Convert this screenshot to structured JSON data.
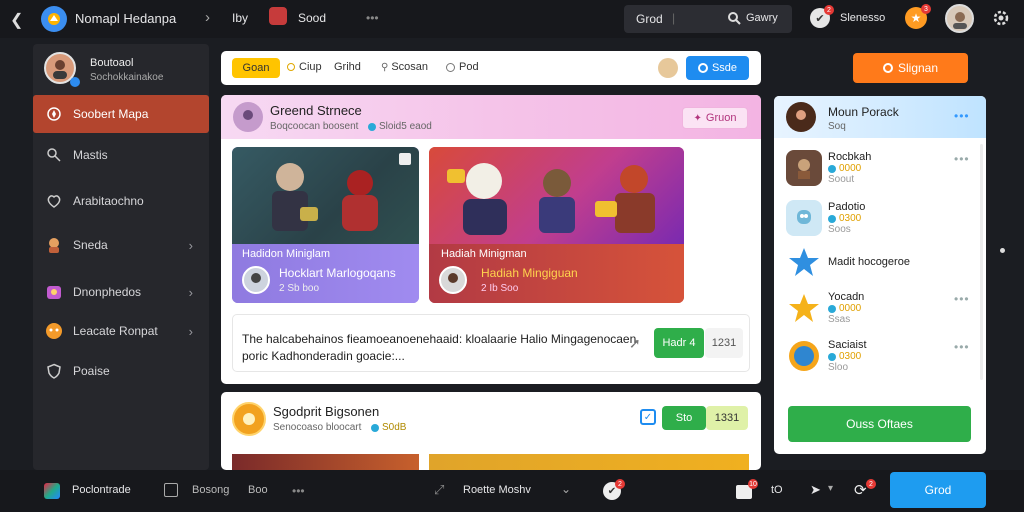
{
  "topbar": {
    "back_icon": "chevron-left-icon",
    "app_title": "Nomapl Hedanpa",
    "crumb_sep": "›",
    "crumb": "Iby",
    "crumb2": "Sood",
    "more": "•••",
    "search_tab": "Grod",
    "search_sep": "|",
    "search_value": "Gawry",
    "notif_badge": "2",
    "user_label": "Slenesso",
    "trophy_badge": "3"
  },
  "sidebar": {
    "profile_name": "Boutoaol",
    "profile_sub": "Sochokkainakoe",
    "items": [
      {
        "label": "Soobert Mapa",
        "icon": "compass-icon",
        "chevron": ""
      },
      {
        "label": "Mastis",
        "icon": "search-person-icon",
        "chevron": ""
      },
      {
        "label": "Arabitaochno",
        "icon": "heart-shield-icon",
        "chevron": ""
      },
      {
        "label": "Sneda",
        "icon": "game-character-icon",
        "chevron": "›"
      },
      {
        "label": "Dnonphedos",
        "icon": "gift-box-icon",
        "chevron": "›"
      },
      {
        "label": "Leacate Ronpat",
        "icon": "controller-icon",
        "chevron": "›"
      },
      {
        "label": "Poaise",
        "icon": "shield-icon",
        "chevron": ""
      }
    ]
  },
  "filterbar": {
    "active": "Goan",
    "chips": [
      "Ciup",
      "Grihd",
      "Scosan",
      "Pod"
    ],
    "action_button": "Ssde"
  },
  "primary_button": "Slignan",
  "feed": {
    "title": "Greend Strnece",
    "sub": "Boqcoocan boosent",
    "sub_stat": "Sloid5 eaod",
    "pill": "Gruon",
    "cards": [
      {
        "banner": "Hadidon Miniglam",
        "name": "Hocklart Marlogoqans",
        "meta": "2 Sb boo"
      },
      {
        "banner": "Hadiah Minigman",
        "name": "Hadiah Mingiguan",
        "meta": "2 Ib Soo"
      }
    ],
    "desc_line1": "The halcabehainos fieamoeanoenehaaid: kloalaarie Halio Mingagenocaen",
    "desc_line2": "poric Kadhonderadin goacie:...",
    "desc_button": "Hadr 4",
    "desc_count": "1231"
  },
  "feed2": {
    "title": "Sgodprit Bigsonen",
    "sub": "Senocoaso bloocart",
    "sub_stat": "S0dB",
    "stat_label": "Sto",
    "stat_value": "1331"
  },
  "rightpanel": {
    "header_title": "Moun Porack",
    "header_sub": "Soq",
    "more": "•••",
    "rows": [
      {
        "title": "Rocbkah",
        "sub": "Soout",
        "amount": "0000",
        "icon": "knight-icon"
      },
      {
        "title": "Padotio",
        "sub": "Soos",
        "amount": "0300",
        "icon": "robot-icon"
      },
      {
        "title": "Madit hocogeroe",
        "sub": "",
        "amount": "",
        "icon": "blue-star-icon"
      },
      {
        "title": "Yocadn",
        "sub": "Ssas",
        "amount": "0000",
        "icon": "gold-star-icon"
      },
      {
        "title": "Saciaist",
        "sub": "Sloo",
        "amount": "0300",
        "icon": "medal-icon"
      }
    ],
    "cta": "Ouss Oftaes"
  },
  "bottombar": {
    "left_label": "Poclontrade",
    "tab1": "Bosong",
    "tab2": "Boo",
    "more": "•••",
    "center_label": "Roette Moshv",
    "notif_badge": "2",
    "count_badge": "10",
    "count_label": "tO",
    "pin_badge": "2",
    "main_button": "Grod"
  },
  "colors": {
    "accent_orange": "#ff7a1a",
    "accent_blue": "#1e8cf0",
    "active_red": "#b3452e",
    "green": "#2fae4a"
  }
}
